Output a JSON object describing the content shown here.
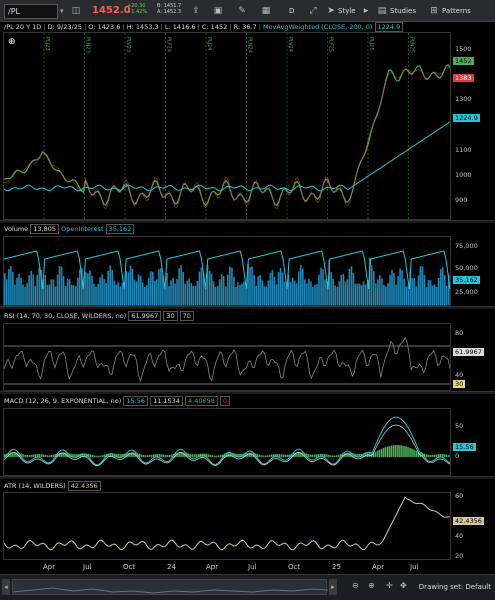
{
  "toolbar": {
    "symbol": "/PL",
    "price": "1452.0",
    "change_top": "+20.30",
    "change_bottom": "+1.42%",
    "bid": "B: 1451.7",
    "ask": "A: 1452.3",
    "style_label": "Style",
    "studies_label": "Studies",
    "patterns_label": "Patterns",
    "d_label": "D"
  },
  "chart_header": {
    "symbol_period": "/PL 20 Y 1D",
    "date": "D: 9/23/25",
    "open": "O: 1423.6",
    "high": "H: 1453.3",
    "low": "L: 1416.6",
    "close": "C: 1452",
    "range": "R: 36.7",
    "study": "MovAvgWeighted (CLOSE, 200, 0)",
    "study_value": "1224.9"
  },
  "price_panel": {
    "y_labels": [
      "1500",
      "1400",
      "1300",
      "1100",
      "1000",
      "900"
    ],
    "last_price_tag": "1452",
    "red_tag": "1383",
    "ma_tag": "1224.9",
    "vertical_markers": [
      "PLJ23",
      "PLN23",
      "PLV23",
      "PLF24",
      "PLJ24",
      "PLN24",
      "PLV24",
      "PLF25",
      "PLJ25",
      "PLN25"
    ]
  },
  "volume_panel": {
    "title": "Volume",
    "volume": "13,805",
    "oi_label": "OpenInterest",
    "oi_value": "35,162",
    "y_labels": [
      "75,000",
      "50,000",
      "25,000"
    ],
    "tag": "35,162"
  },
  "rsi_panel": {
    "title": "RSI (14, 70, 30, CLOSE, WILDERS, no)",
    "value": "61.9967",
    "ob": "30",
    "os": "70",
    "y_labels": [
      "80",
      "60",
      "40"
    ],
    "tag": "61.9967",
    "tag_low": "30"
  },
  "macd_panel": {
    "title": "MACD (12, 26, 9, EXPONENTIAL, no)",
    "value": "15.56",
    "avg": "11.1534",
    "diff": "4.40658",
    "zero": "0",
    "y_labels": [
      "50",
      "25",
      "0"
    ],
    "tag": "15.56"
  },
  "atr_panel": {
    "title": "ATR (14, WILDERS)",
    "value": "42.4356",
    "y_labels": [
      "60",
      "40",
      "20"
    ],
    "tag": "42.4356"
  },
  "x_axis": [
    "Apr",
    "Jul",
    "Oct",
    "24",
    "Apr",
    "Jul",
    "Oct",
    "25",
    "Apr",
    "Jul"
  ],
  "footer": {
    "drawing_set": "Drawing set: Default"
  },
  "colors": {
    "price_up": "#4caf50",
    "price_down": "#e53935",
    "ma": "#26c6da",
    "volume": "#1e88b8",
    "atr": "#d8c7a0"
  }
}
